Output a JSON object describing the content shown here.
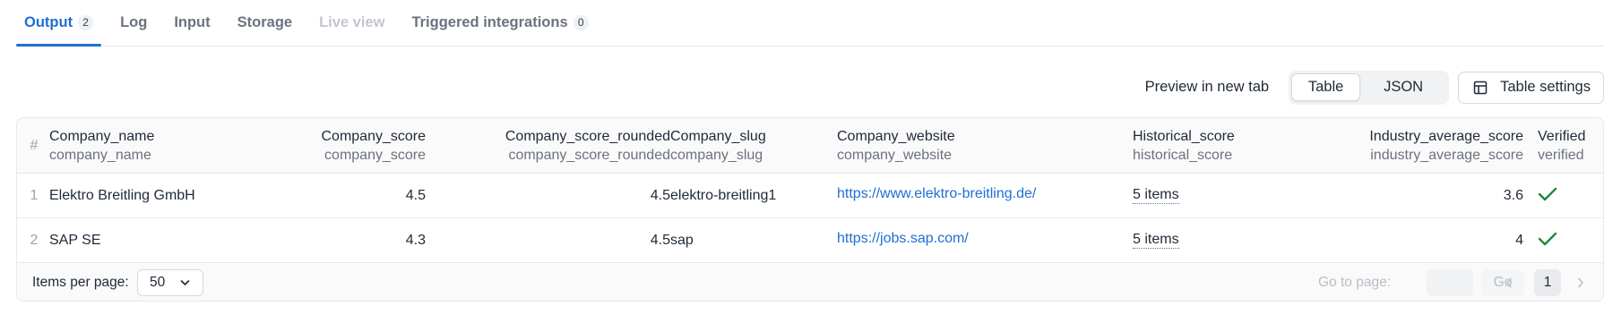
{
  "tabs": [
    {
      "label": "Output",
      "badge": "2"
    },
    {
      "label": "Log"
    },
    {
      "label": "Input"
    },
    {
      "label": "Storage"
    },
    {
      "label": "Live view"
    },
    {
      "label": "Triggered integrations",
      "badge": "0"
    }
  ],
  "toolbar": {
    "preview_label": "Preview in new tab",
    "view_options": [
      "Table",
      "JSON"
    ],
    "selected_view": "Table",
    "settings_label": "Table settings"
  },
  "table": {
    "index_header": "#",
    "columns": [
      {
        "title": "Company_name",
        "field": "company_name"
      },
      {
        "title": "Company_score",
        "field": "company_score"
      },
      {
        "title": "Company_score_rounded",
        "field": "company_score_rounded"
      },
      {
        "title": "Company_slug",
        "field": "company_slug"
      },
      {
        "title": "Company_website",
        "field": "company_website"
      },
      {
        "title": "Historical_score",
        "field": "historical_score"
      },
      {
        "title": "Industry_average_score",
        "field": "industry_average_score"
      },
      {
        "title": "Verified",
        "field": "verified"
      }
    ],
    "rows": [
      {
        "index": "1",
        "company_name": "Elektro Breitling GmbH",
        "company_score": "4.5",
        "company_score_rounded": "4.5",
        "company_slug": "elektro-breitling1",
        "company_website": "https://www.elektro-breitling.de/",
        "historical_score": "5 items",
        "industry_average_score": "3.6",
        "verified": true
      },
      {
        "index": "2",
        "company_name": "SAP SE",
        "company_score": "4.3",
        "company_score_rounded": "4.5",
        "company_slug": "sap",
        "company_website": "https://jobs.sap.com/",
        "historical_score": "5 items",
        "industry_average_score": "4",
        "verified": true
      }
    ]
  },
  "pagination": {
    "items_per_page_label": "Items per page:",
    "items_per_page": "50",
    "goto_label": "Go to page:",
    "go_label": "Go",
    "current_page": "1"
  },
  "colors": {
    "accent": "#1f6fd1",
    "verified": "#1a8a3a"
  },
  "icons": {
    "table_settings": "table-layout-icon",
    "verified": "checkmark-icon",
    "dropdown": "chevron-down-icon",
    "prev": "chevron-left-icon",
    "next": "chevron-right-icon"
  }
}
